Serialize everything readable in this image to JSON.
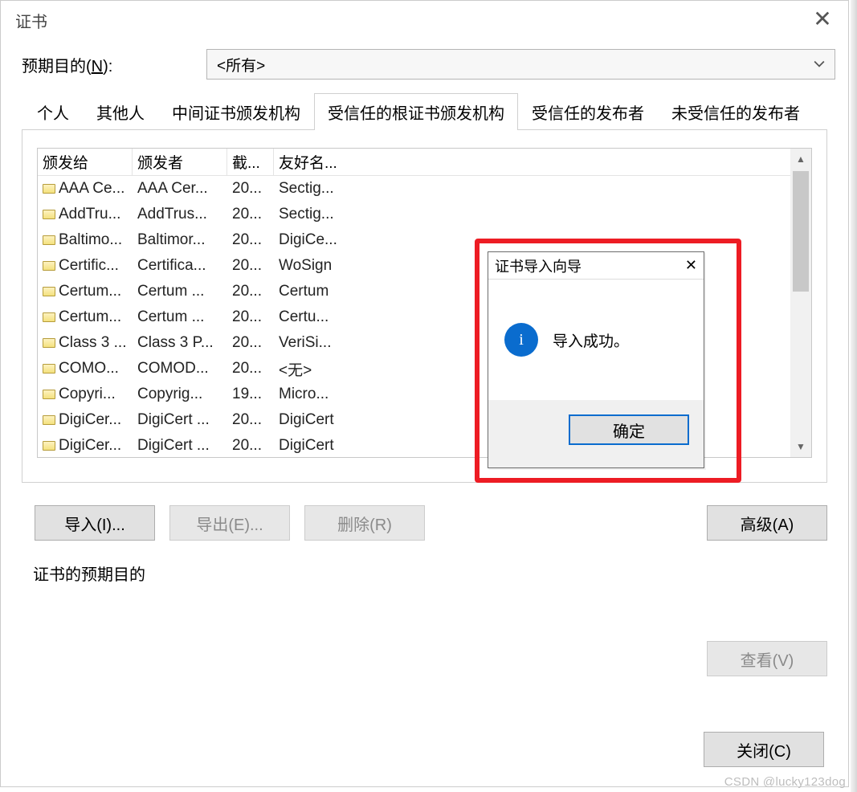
{
  "window": {
    "title": "证书",
    "close_glyph": "✕"
  },
  "purpose": {
    "label": "预期目的(",
    "label_accel": "N",
    "label_suffix": "):",
    "value": "<所有>"
  },
  "tabs": {
    "items": [
      {
        "label": "个人",
        "active": false
      },
      {
        "label": "其他人",
        "active": false
      },
      {
        "label": "中间证书颁发机构",
        "active": false
      },
      {
        "label": "受信任的根证书颁发机构",
        "active": true
      },
      {
        "label": "受信任的发布者",
        "active": false
      },
      {
        "label": "未受信任的发布者",
        "active": false
      }
    ]
  },
  "columns": {
    "issued_to": "颁发给",
    "issued_by": "颁发者",
    "expiry": "截...",
    "friendly": "友好名..."
  },
  "rows": [
    {
      "to": "AAA Ce...",
      "by": "AAA Cer...",
      "exp": "20...",
      "fn": "Sectig..."
    },
    {
      "to": "AddTru...",
      "by": "AddTrus...",
      "exp": "20...",
      "fn": "Sectig..."
    },
    {
      "to": "Baltimo...",
      "by": "Baltimor...",
      "exp": "20...",
      "fn": "DigiCe..."
    },
    {
      "to": "Certific...",
      "by": "Certifica...",
      "exp": "20...",
      "fn": "WoSign"
    },
    {
      "to": "Certum...",
      "by": "Certum ...",
      "exp": "20...",
      "fn": "Certum"
    },
    {
      "to": "Certum...",
      "by": "Certum ...",
      "exp": "20...",
      "fn": "Certu..."
    },
    {
      "to": "Class 3 ...",
      "by": "Class 3 P...",
      "exp": "20...",
      "fn": "VeriSi..."
    },
    {
      "to": "COMO...",
      "by": "COMOD...",
      "exp": "20...",
      "fn": "<无>"
    },
    {
      "to": "Copyri...",
      "by": "Copyrig...",
      "exp": "19...",
      "fn": "Micro..."
    },
    {
      "to": "DigiCer...",
      "by": "DigiCert ...",
      "exp": "20...",
      "fn": "DigiCert"
    },
    {
      "to": "DigiCer...",
      "by": "DigiCert ...",
      "exp": "20...",
      "fn": "DigiCert"
    }
  ],
  "buttons": {
    "import": "导入(I)...",
    "export": "导出(E)...",
    "delete": "删除(R)",
    "advanced": "高级(A)",
    "view": "查看(V)",
    "close": "关闭(C)"
  },
  "section": {
    "purpose_details": "证书的预期目的"
  },
  "dialog": {
    "title": "证书导入向导",
    "close_glyph": "✕",
    "info_glyph": "i",
    "message": "导入成功。",
    "ok": "确定"
  },
  "watermark": "CSDN @lucky123dog"
}
